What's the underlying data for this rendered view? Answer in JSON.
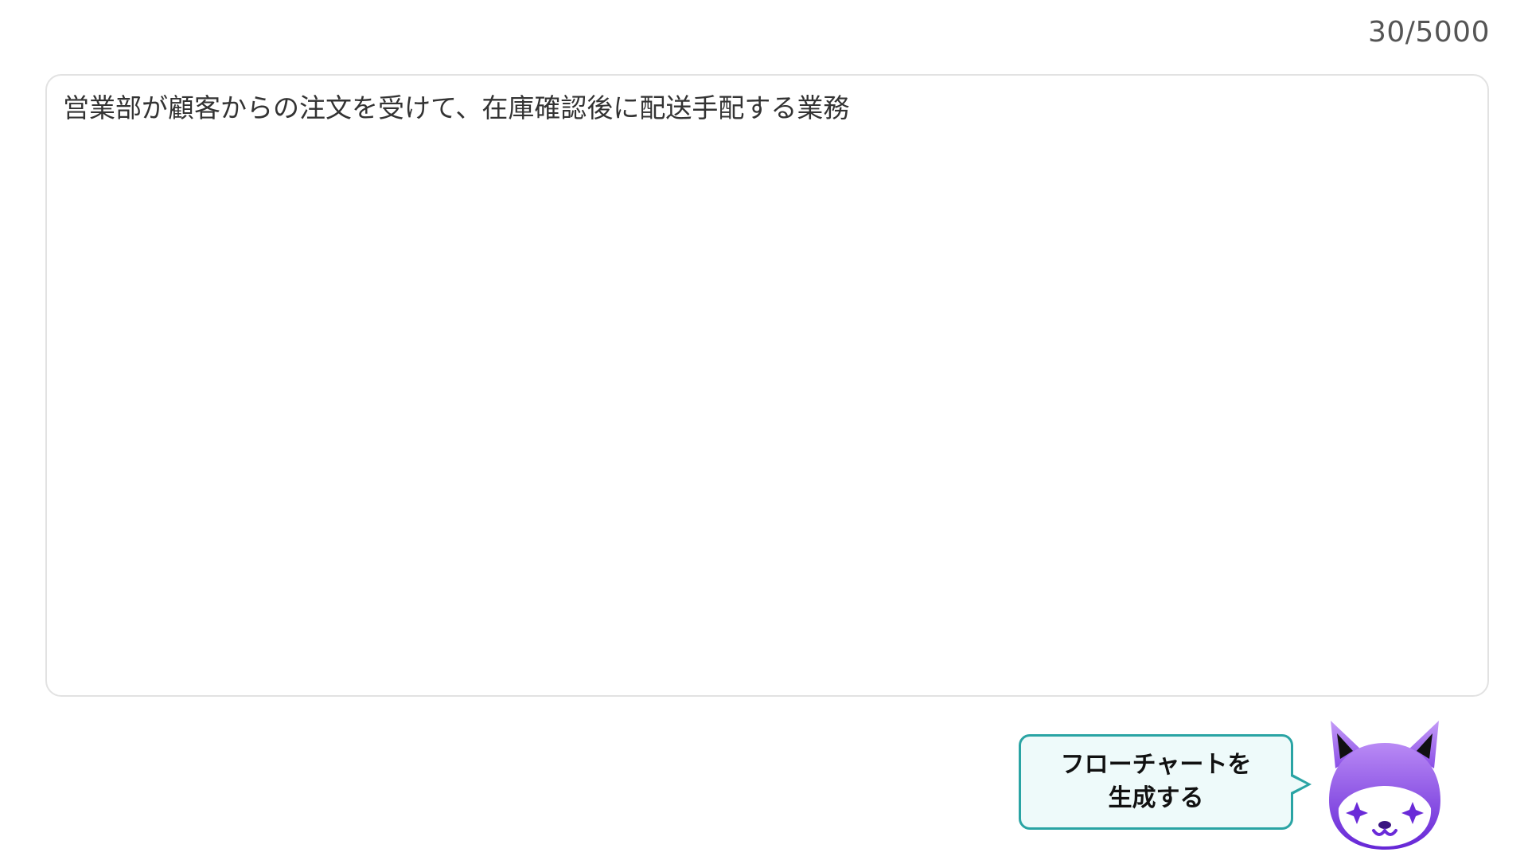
{
  "counter": {
    "text": "30/5000",
    "current": 30,
    "max": 5000
  },
  "input": {
    "value": "営業部が顧客からの注文を受けて、在庫確認後に配送手配する業務"
  },
  "generate": {
    "label": "フローチャートを\n生成する",
    "mascot_icon": "fox-mascot-icon"
  },
  "colors": {
    "bubble_border": "#2aa4a4",
    "bubble_bg": "#eefafa",
    "mascot_gradient_top": "#b57cf2",
    "mascot_gradient_bottom": "#6a2ad8",
    "input_border": "#e2e2e2"
  }
}
